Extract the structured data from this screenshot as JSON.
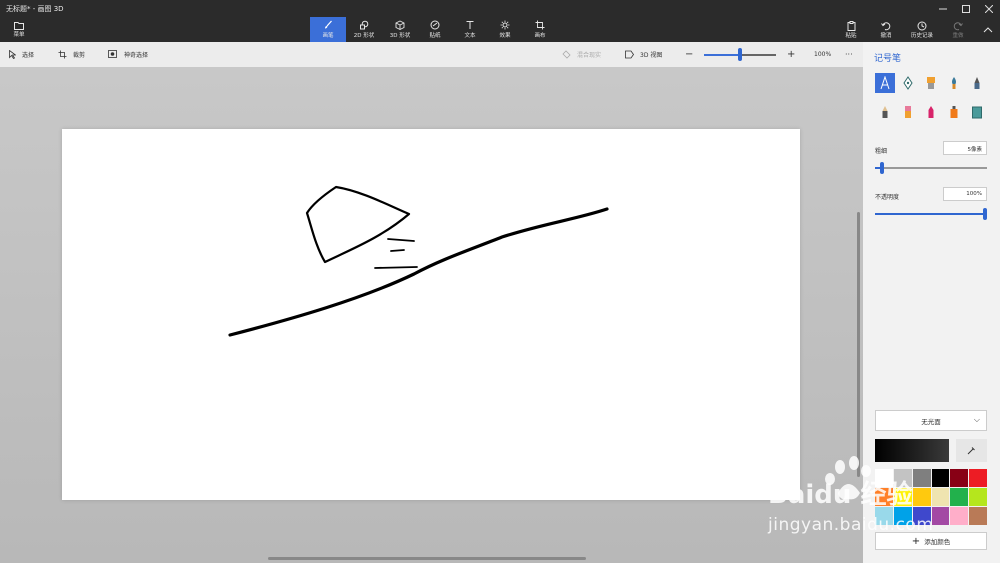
{
  "window": {
    "title": "无标题* - 画图 3D",
    "controls": [
      "minimize",
      "maximize",
      "close"
    ]
  },
  "menu": {
    "label": "菜单"
  },
  "tabs": [
    {
      "label": "画笔",
      "icon": "brush-icon",
      "active": true
    },
    {
      "label": "2D 形状",
      "icon": "shapes-2d-icon"
    },
    {
      "label": "3D 形状",
      "icon": "cube-icon"
    },
    {
      "label": "贴纸",
      "icon": "sticker-icon"
    },
    {
      "label": "文本",
      "icon": "text-icon"
    },
    {
      "label": "效果",
      "icon": "effects-icon"
    },
    {
      "label": "画布",
      "icon": "canvas-icon"
    }
  ],
  "actions": {
    "paste": "粘贴",
    "undo": "撤消",
    "history": "历史记录",
    "redo": "重做"
  },
  "subtoolbar": {
    "select": "选择",
    "crop": "裁剪",
    "magic_select": "神奇选择",
    "mixed_reality": "混合现实",
    "view_3d": "3D 视图",
    "zoom_minus": "−",
    "zoom_plus": "+",
    "zoom_level": "100%",
    "more": "···",
    "zoom_fraction": 0.5
  },
  "panel": {
    "title": "记号笔",
    "brushes": [
      "marker-icon",
      "calligraphy-pen-icon",
      "oil-brush-icon",
      "watercolor-icon",
      "pixel-pen-icon",
      "pencil-icon",
      "eraser-icon",
      "crayon-icon",
      "spray-can-icon",
      "fill-icon"
    ],
    "thickness_label": "粗细",
    "thickness_value": "5像素",
    "thickness_fraction": 0.05,
    "opacity_label": "不透明度",
    "opacity_value": "100%",
    "opacity_fraction": 1.0,
    "finish": "无光面",
    "current_color": "#000000",
    "add_color": "添加颜色",
    "palette": [
      "#ffffff",
      "#c3c3c3",
      "#7f7f7f",
      "#000000",
      "#880015",
      "#ed1c24",
      "#ff7f27",
      "#fff200",
      "#ffc90e",
      "#efe4b0",
      "#22b14c",
      "#b5e61d",
      "#99d9ea",
      "#00a2e8",
      "#3f48cc",
      "#a349a4",
      "#ffaec9",
      "#b97a57"
    ]
  },
  "watermark": {
    "brand_text": "Baidu 经验",
    "url": "jingyan.baidu.com"
  }
}
